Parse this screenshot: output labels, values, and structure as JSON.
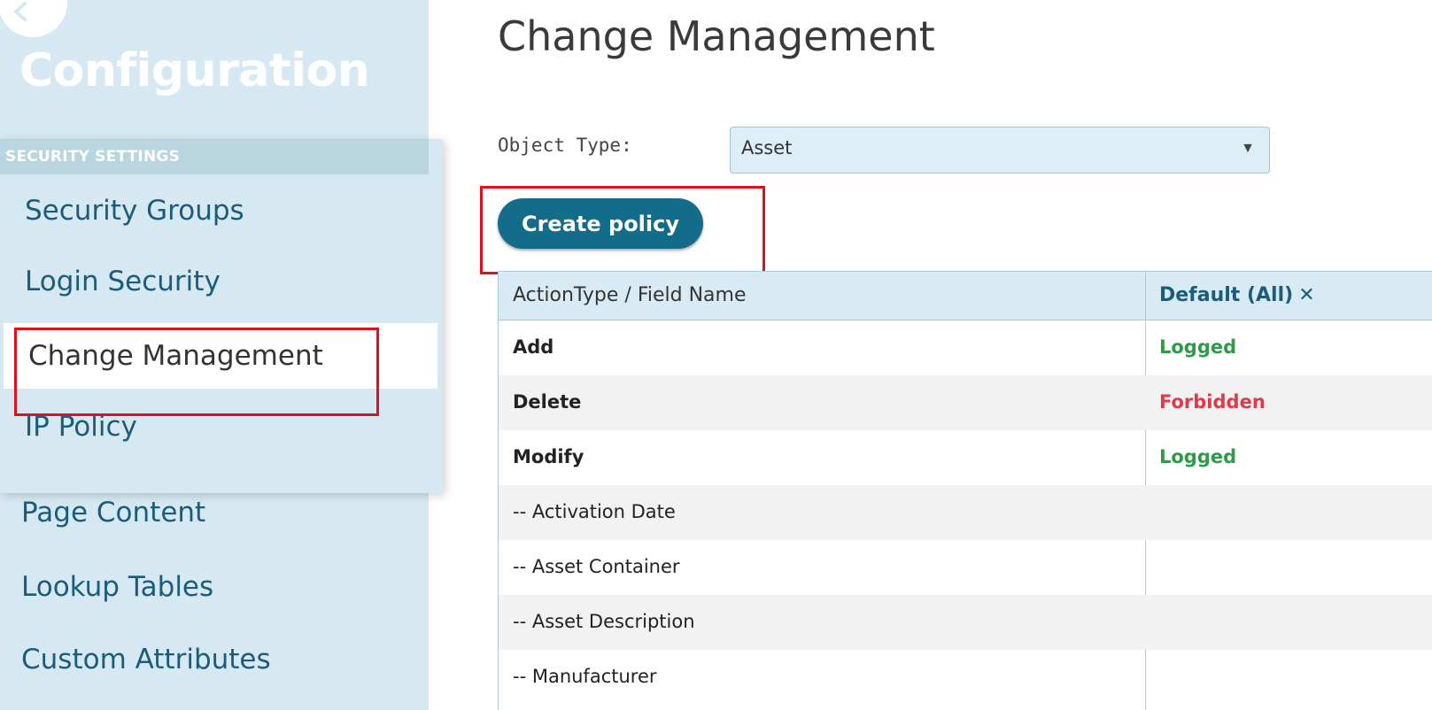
{
  "sidebar": {
    "title": "Configuration",
    "section_header": "SECURITY SETTINGS",
    "section_items": [
      {
        "label": "Security Groups"
      },
      {
        "label": "Login Security"
      },
      {
        "label": "Change Management"
      },
      {
        "label": "IP Policy"
      }
    ],
    "other_items": [
      {
        "label": "Page Content"
      },
      {
        "label": "Lookup Tables"
      },
      {
        "label": "Custom Attributes"
      }
    ],
    "active_item": "Change Management"
  },
  "main": {
    "title": "Change Management",
    "object_type_label": "Object Type:",
    "object_type_value": "Asset",
    "create_policy_label": "Create policy",
    "table": {
      "headers": [
        "ActionType / Field Name",
        "Default (All)"
      ],
      "header_remove_icon": "✕",
      "rows": [
        {
          "name": "Add",
          "status": "Logged"
        },
        {
          "name": "Delete",
          "status": "Forbidden"
        },
        {
          "name": "Modify",
          "status": "Logged"
        },
        {
          "name": "-- Activation Date",
          "status": ""
        },
        {
          "name": "-- Asset Container",
          "status": ""
        },
        {
          "name": "-- Asset Description",
          "status": ""
        },
        {
          "name": "-- Manufacturer",
          "status": ""
        }
      ]
    }
  },
  "colors": {
    "sidebar_bg": "#d6e9f2",
    "accent": "#136c8a",
    "logged": "#2e9a4a",
    "forbidden": "#e03a4a",
    "annotation": "#e0101a"
  },
  "icons": {
    "back": "back-arrow-icon",
    "dropdown": "dropdown-caret-icon",
    "remove": "close-icon"
  }
}
